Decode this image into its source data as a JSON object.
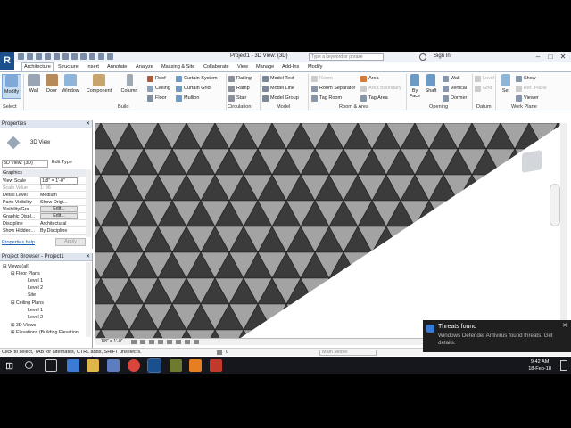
{
  "window": {
    "title": "Project1 - 3D View: {3D}",
    "search_placeholder": "Type a keyword or phrase",
    "signin": "Sign In"
  },
  "tabs": [
    "Architecture",
    "Structure",
    "Insert",
    "Annotate",
    "Analyze",
    "Massing & Site",
    "Collaborate",
    "View",
    "Manage",
    "Add-Ins",
    "Modify"
  ],
  "ribbon": {
    "big": [
      "Modify",
      "Wall",
      "Door",
      "Window",
      "Component",
      "Column",
      "By Face",
      "Shaft",
      "Set"
    ],
    "build_small": [
      "Roof",
      "Ceiling",
      "Floor",
      "Curtain System",
      "Curtain Grid",
      "Mullion"
    ],
    "circulation": [
      "Railing",
      "Ramp",
      "Stair"
    ],
    "model": [
      "Model Text",
      "Model Line",
      "Model Group"
    ],
    "room_area": [
      "Room",
      "Room Separator",
      "Tag Room",
      "Area",
      "Area Boundary",
      "Tag Area"
    ],
    "opening": [
      "Wall",
      "Vertical",
      "Dormer"
    ],
    "datum": [
      "Level",
      "Grid"
    ],
    "workplane": [
      "Show",
      "Ref. Plane",
      "Viewer"
    ],
    "panels": [
      "Select",
      "Build",
      "Circulation",
      "Model",
      "Room & Area",
      "Opening",
      "Datum",
      "Work Plane"
    ]
  },
  "properties": {
    "header": "Properties",
    "type_name": "3D View",
    "instance": "3D View: {3D}",
    "edit_type": "Edit Type",
    "group": "Graphics",
    "rows": [
      {
        "k": "View Scale",
        "v": "1/8\" = 1'-0\""
      },
      {
        "k": "Scale Value",
        "v": "1: 96"
      },
      {
        "k": "Detail Level",
        "v": "Medium"
      },
      {
        "k": "Parts Visibility",
        "v": "Show Origi..."
      },
      {
        "k": "Visibility/Gra...",
        "v": "Edit..."
      },
      {
        "k": "Graphic Displ...",
        "v": "Edit..."
      },
      {
        "k": "Discipline",
        "v": "Architectural"
      },
      {
        "k": "Show Hidden...",
        "v": "By Discipline"
      }
    ],
    "help": "Properties help",
    "apply": "Apply"
  },
  "browser": {
    "header": "Project Browser - Project1",
    "items": [
      {
        "t": "Views (all)",
        "lvl": 0
      },
      {
        "t": "Floor Plans",
        "lvl": 1
      },
      {
        "t": "Level 1",
        "lvl": 2
      },
      {
        "t": "Level 2",
        "lvl": 2
      },
      {
        "t": "Site",
        "lvl": 2
      },
      {
        "t": "Ceiling Plans",
        "lvl": 1
      },
      {
        "t": "Level 1",
        "lvl": 2
      },
      {
        "t": "Level 2",
        "lvl": 2
      },
      {
        "t": "3D Views",
        "lvl": 1
      },
      {
        "t": "Elevations (Building Elevation",
        "lvl": 1
      }
    ]
  },
  "view": {
    "scale": "1/8\" = 1'-0\"",
    "zero": "0",
    "model": "Main Model"
  },
  "status": {
    "text": "Click to select, TAB for alternates, CTRL adds, SHIFT unselects."
  },
  "toast": {
    "title": "Threats found",
    "body": "Windows Defender Antivirus found threats. Get details."
  },
  "clock": {
    "time": "9:42 AM",
    "date": "18-Feb-18"
  },
  "colors": {
    "tri_dark": "#3b3b3b",
    "tri_light": "#a3a3a3",
    "accent": "#1c4f8e"
  }
}
